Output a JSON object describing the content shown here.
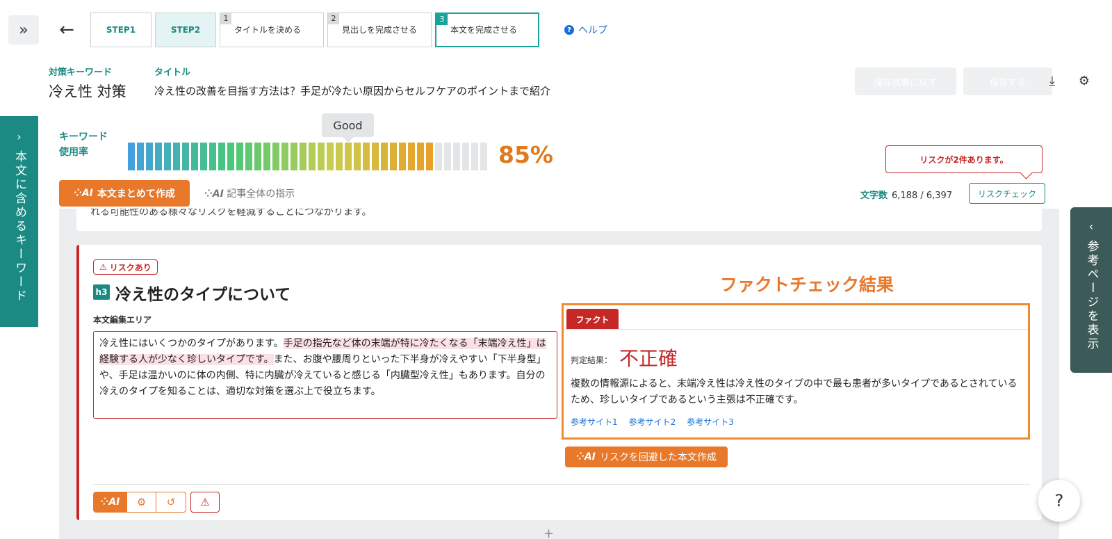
{
  "header": {
    "steps": [
      {
        "label": "STEP1"
      },
      {
        "label": "STEP2"
      }
    ],
    "substeps": [
      {
        "num": "1",
        "label": "タイトルを決める"
      },
      {
        "num": "2",
        "label": "見出しを完成させる"
      },
      {
        "num": "3",
        "label": "本文を完成させる"
      }
    ],
    "help": "ヘルプ"
  },
  "meta": {
    "keyword_label": "対策キーワード",
    "keyword": "冷え性 対策",
    "title_label": "タイトル",
    "title": "冷え性の改善を目指す方法は？手足が冷たい原因からセルフケアのポイントまで紹介"
  },
  "actions": {
    "restore": "保存状態に戻す",
    "save": "保存する"
  },
  "side": {
    "left_tab": "本文に含めるキーワード",
    "right_tab": "参考ページを表示"
  },
  "usage": {
    "label_line1": "キーワード",
    "label_line2": "使用率",
    "rating": "Good",
    "percent_label": "85%",
    "percent": 85
  },
  "toolbar": {
    "summary_btn": "本文まとめて作成",
    "instruction": "記事全体の指示",
    "risk_callout": "リスクが2件あります。",
    "char_label": "文字数",
    "char_value": "6,188 / 6,397",
    "risk_check": "リスクチェック"
  },
  "prev_card_text": "れる可能性のある様々なリスクを軽減することにつながります。",
  "section": {
    "risk_tag": "リスクあり",
    "level": "h3",
    "heading": "冷え性のタイプについて",
    "edit_label": "本文編集エリア",
    "body_pre": "冷え性にはいくつかのタイプがあります。",
    "body_highlight": "手足の指先など体の末端が特に冷たくなる「末端冷え性」は経験する人が少なく珍しいタイプです。",
    "body_post": "また、お腹や腰周りといった下半身が冷えやすい「下半身型」や、手足は温かいのに体の内側、特に内臓が冷えていると感じる「内臓型冷え性」もあります。自分の冷えのタイプを知ることは、適切な対策を選ぶ上で役立ちます。"
  },
  "factcheck": {
    "title": "ファクトチェック結果",
    "tab": "ファクト",
    "verdict_label": "判定結果：",
    "verdict": "不正確",
    "explanation": "複数の情報源によると、末端冷え性は冷え性のタイプの中で最も患者が多いタイプであるとされているため、珍しいタイプであるという主張は不正確です。",
    "refs": [
      "参考サイト1",
      "参考サイト2",
      "参考サイト3"
    ],
    "avoid_btn": "リスクを回避した本文作成"
  },
  "ai_label": "AI",
  "help_fab": "?",
  "colors": {
    "accent": "#1a8a82",
    "orange": "#e8782a",
    "risk": "#c62828"
  }
}
